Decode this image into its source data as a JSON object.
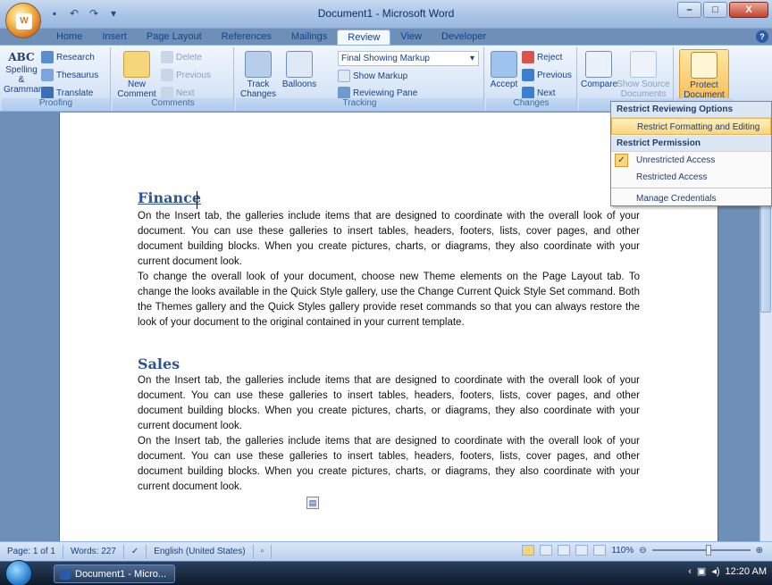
{
  "window": {
    "title": "Document1 - Microsoft Word",
    "controls": [
      "–",
      "□",
      "X"
    ]
  },
  "qat": {
    "save_icon": "save-icon",
    "undo_icon": "undo-icon",
    "redo_icon": "redo-icon"
  },
  "tabs": [
    {
      "label": "Home"
    },
    {
      "label": "Insert"
    },
    {
      "label": "Page Layout"
    },
    {
      "label": "References"
    },
    {
      "label": "Mailings"
    },
    {
      "label": "Review"
    },
    {
      "label": "View"
    },
    {
      "label": "Developer"
    }
  ],
  "ribbon": {
    "proofing": {
      "name": "Proofing",
      "spelling": "Spelling &\nGrammar",
      "abc": "ABC",
      "research": "Research",
      "thesaurus": "Thesaurus",
      "translate": "Translate"
    },
    "comments": {
      "name": "Comments",
      "new_comment": "New\nComment",
      "delete": "Delete",
      "previous": "Previous",
      "next": "Next"
    },
    "tracking": {
      "name": "Tracking",
      "track_changes": "Track\nChanges",
      "balloons": "Balloons",
      "display": "Final Showing Markup",
      "show_markup": "Show Markup",
      "reviewing_pane": "Reviewing Pane"
    },
    "changes": {
      "name": "Changes",
      "accept": "Accept",
      "reject": "Reject",
      "previous": "Previous",
      "next": "Next"
    },
    "compare": {
      "compare": "Compare",
      "show_source": "Show Source\nDocuments"
    },
    "protect": {
      "protect_document": "Protect\nDocument"
    }
  },
  "menu": {
    "header1": "Restrict Reviewing Options",
    "item_formatting": "Restrict Formatting and Editing",
    "header2": "Restrict Permission",
    "item_unrestricted": "Unrestricted Access",
    "item_restricted": "Restricted Access",
    "item_credentials": "Manage Credentials"
  },
  "document": {
    "heading1": "Finance",
    "p1": "On the Insert tab, the galleries include items that are designed to coordinate with the overall look of your document. You can use these galleries to insert tables, headers, footers, lists, cover pages, and other document building blocks. When you create pictures, charts, or diagrams, they also coordinate with your current document look.",
    "p2": "To change the overall look of your document, choose new Theme elements on the Page Layout tab. To change the looks available in the Quick Style gallery, use the Change Current Quick Style Set command. Both the Themes gallery and the Quick Styles gallery provide reset commands so that you can always restore the look of your document to the original contained in your current template.",
    "heading2": "Sales",
    "p3": "On the Insert tab, the galleries include items that are designed to coordinate with the overall look of your document. You can use these galleries to insert tables, headers, footers, lists, cover pages, and other document building blocks. When you create pictures, charts, or diagrams, they also coordinate with your current document look.",
    "p4": "On the Insert tab, the galleries include items that are designed to coordinate with the overall look of your document. You can use these galleries to insert tables, headers, footers, lists, cover pages, and other document building blocks. When you create pictures, charts, or diagrams, they also coordinate with your current document look."
  },
  "status": {
    "page": "Page: 1 of 1",
    "words": "Words: 227",
    "language": "English (United States)",
    "zoom": "110%"
  },
  "taskbar": {
    "item": "Document1 - Micro...",
    "time": "12:20 AM"
  }
}
